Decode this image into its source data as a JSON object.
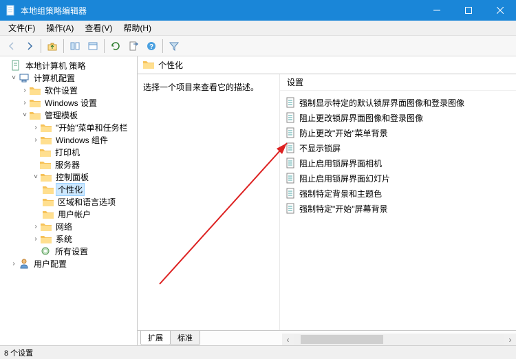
{
  "window": {
    "title": "本地组策略编辑器"
  },
  "menu": {
    "file": "文件(F)",
    "action": "操作(A)",
    "view": "查看(V)",
    "help": "帮助(H)"
  },
  "tree": {
    "root": "本地计算机 策略",
    "computerConfig": "计算机配置",
    "software": "软件设置",
    "windowsSettings": "Windows 设置",
    "adminTemplates": "管理模板",
    "startMenuTaskbar": "\"开始\"菜单和任务栏",
    "windowsComponents": "Windows 组件",
    "printers": "打印机",
    "server": "服务器",
    "controlPanel": "控制面板",
    "personalization": "个性化",
    "regionLanguage": "区域和语言选项",
    "userAccounts": "用户帐户",
    "network": "网络",
    "system": "系统",
    "allSettings": "所有设置",
    "userConfig": "用户配置"
  },
  "content": {
    "heading": "个性化",
    "desc": "选择一个项目来查看它的描述。",
    "columnHeader": "设置",
    "items": [
      "强制显示特定的默认锁屏界面图像和登录图像",
      "阻止更改锁屏界面图像和登录图像",
      "防止更改\"开始\"菜单背景",
      "不显示锁屏",
      "阻止启用锁屏界面相机",
      "阻止启用锁屏界面幻灯片",
      "强制特定背景和主题色",
      "强制特定\"开始\"屏幕背景"
    ]
  },
  "tabs": {
    "extended": "扩展",
    "standard": "标准"
  },
  "status": "8 个设置"
}
